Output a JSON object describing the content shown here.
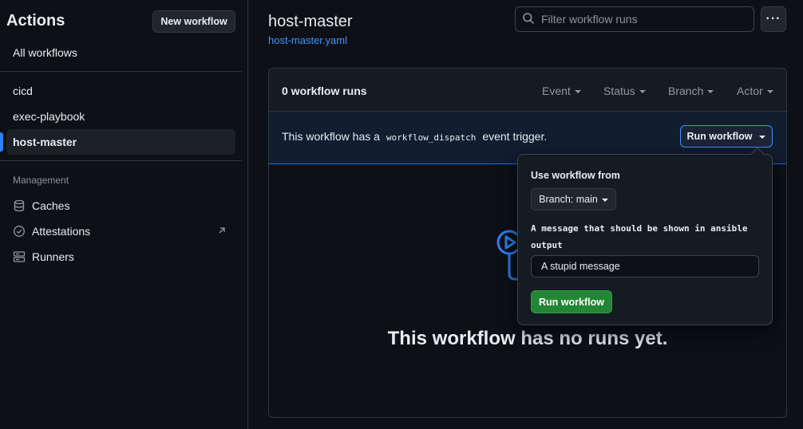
{
  "sidebar": {
    "title": "Actions",
    "new_workflow_label": "New workflow",
    "all_workflows_label": "All workflows",
    "workflows": [
      {
        "label": "cicd"
      },
      {
        "label": "exec-playbook"
      },
      {
        "label": "host-master"
      }
    ],
    "active_workflow": "host-master",
    "management_label": "Management",
    "management_items": [
      {
        "label": "Caches",
        "icon": "database-icon"
      },
      {
        "label": "Attestations",
        "icon": "verified-icon"
      },
      {
        "label": "Runners",
        "icon": "server-icon"
      }
    ]
  },
  "header": {
    "title": "host-master",
    "file_link": "host-master.yaml",
    "filter_placeholder": "Filter workflow runs",
    "more_label": "···"
  },
  "runs": {
    "count_label": "0 workflow runs",
    "filters": [
      {
        "label": "Event"
      },
      {
        "label": "Status"
      },
      {
        "label": "Branch"
      },
      {
        "label": "Actor"
      }
    ],
    "dispatch_prefix": "This workflow has a",
    "dispatch_code": "workflow_dispatch",
    "dispatch_suffix": "event trigger.",
    "run_workflow_label": "Run workflow",
    "empty_title": "This workflow has no runs yet."
  },
  "dropdown": {
    "use_from_label": "Use workflow from",
    "branch_label": "Branch: main",
    "message_label": "A message that should be shown in ansible output",
    "message_value": "A stupid message",
    "submit_label": "Run workflow"
  },
  "colors": {
    "background": "#0d1117",
    "accent_blue": "#2f81f7",
    "link_blue": "#4493f8",
    "run_green": "#238636"
  }
}
